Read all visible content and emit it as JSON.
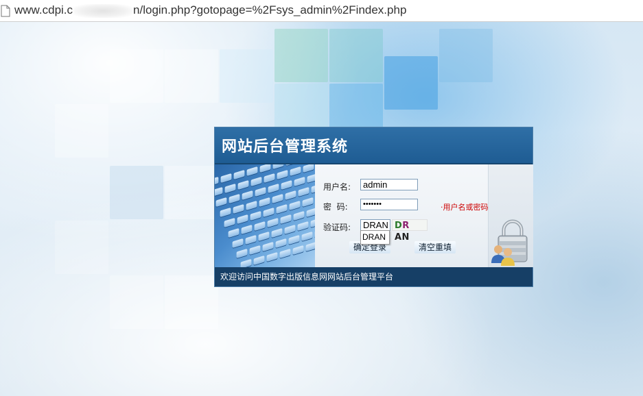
{
  "browser": {
    "url_prefix": "www.cdpi.c",
    "url_suffix": "n/login.php?gotopage=%2Fsys_admin%2Findex.php"
  },
  "login": {
    "title": "网站后台管理系统",
    "username_label": "用户名:",
    "username_value": "admin",
    "password_label": "密  码:",
    "password_value": "•••••••",
    "captcha_label": "验证码:",
    "captcha_value": "DRAN",
    "captcha_image": {
      "part1": "D",
      "part2": "R",
      "part3": "AN"
    },
    "autocomplete_suggestion": "DRAN",
    "error_message": "·用户名或密码错误",
    "confirm_button": "确定登录",
    "reset_button": "清空重填",
    "footer": "欢迎访问中国数字出版信息网网站后台管理平台"
  },
  "colors": {
    "header": "#1e5c93",
    "footer": "#163f66",
    "error": "#cc0000"
  }
}
